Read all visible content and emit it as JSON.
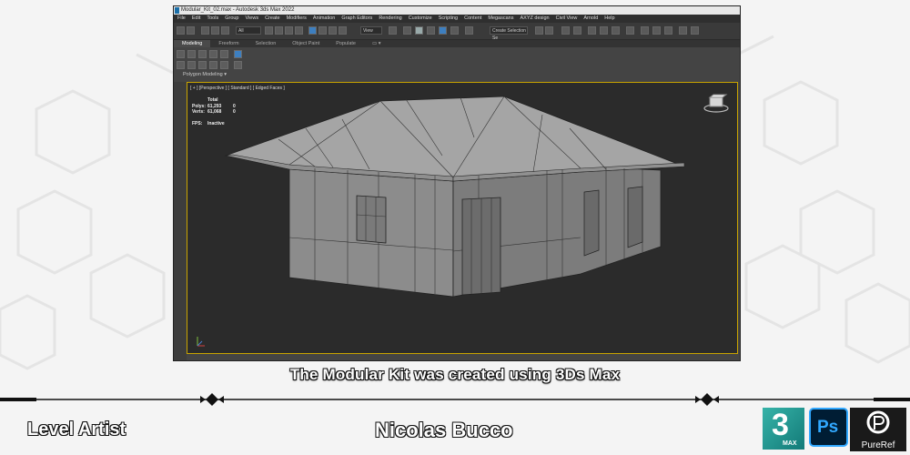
{
  "window": {
    "title": "Modular_Kit_02.max - Autodesk 3ds Max 2022"
  },
  "menu": [
    "File",
    "Edit",
    "Tools",
    "Group",
    "Views",
    "Create",
    "Modifiers",
    "Animation",
    "Graph Editors",
    "Rendering",
    "Customize",
    "Scripting",
    "Content",
    "Megascans",
    "AXYZ design",
    "Civil View",
    "Arnold",
    "Help"
  ],
  "toolbar": {
    "selection_filter": "All",
    "reference_coord": "View",
    "selection_set": "Create Selection Se"
  },
  "ribbon": {
    "tabs": [
      "Modeling",
      "Freeform",
      "Selection",
      "Object Paint",
      "Populate"
    ],
    "active_tab": "Modeling",
    "panel_label": "Polygon Modeling ▾"
  },
  "viewport": {
    "label": "[ + ] [Perspective ] [ Standard ] [ Edged Faces ]",
    "stats": {
      "header": "Total",
      "polys_label": "Polys:",
      "polys_value": "61,293",
      "polys_sel": "0",
      "verts_label": "Verts:",
      "verts_value": "61,068",
      "verts_sel": "0",
      "fps_label": "FPS:",
      "fps_value": "Inactive"
    }
  },
  "caption": "The Modular Kit was created using 3Ds Max",
  "footer": {
    "role": "Level Artist",
    "name": "Nicolas Bucco"
  },
  "logos": {
    "max_big": "3",
    "max_small": "MAX",
    "ps": "Ps",
    "pureref": "PureRef"
  },
  "colors": {
    "viewport_border": "#c9a400",
    "max_logo": "#36b3a8",
    "ps_blue": "#31a8ff"
  }
}
